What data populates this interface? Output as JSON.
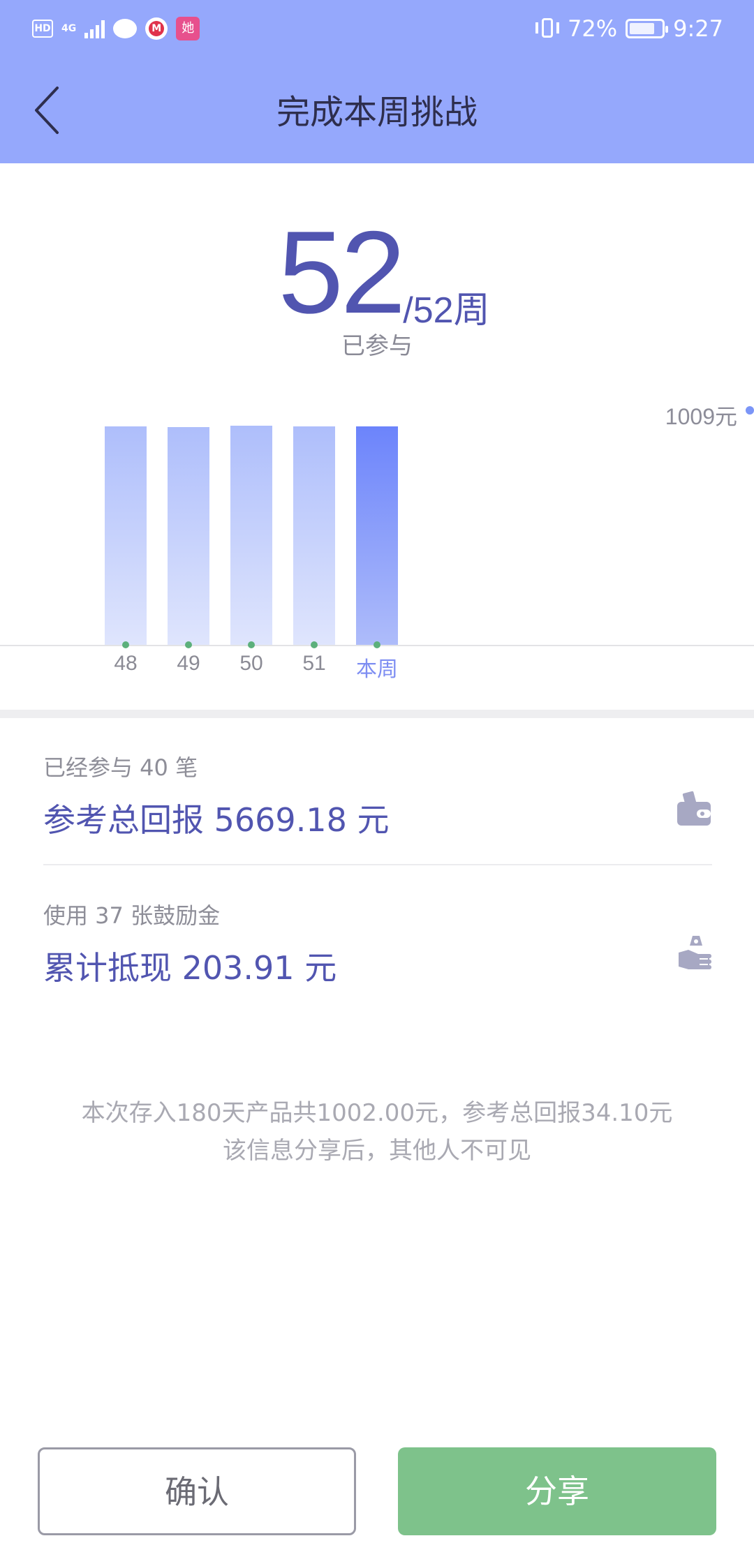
{
  "status_bar": {
    "hd": "HD",
    "network": "4G",
    "app_badge": "她",
    "battery": "72%",
    "time": "9:27"
  },
  "header": {
    "title": "完成本周挑战",
    "background": "#95a8fc"
  },
  "counter": {
    "current": "52",
    "total": "/52周",
    "label": "已参与"
  },
  "chart_data": {
    "type": "bar",
    "goal_label": "1009元",
    "categories": [
      "48",
      "49",
      "50",
      "51",
      "本周"
    ],
    "values": [
      1007,
      1004,
      1009,
      1007,
      1006
    ],
    "ylim": [
      0,
      1009
    ],
    "highlight_index": 4
  },
  "stats": [
    {
      "sub": "已经参与 40 笔",
      "main": "参考总回报 5669.18 元",
      "icon": "wallet-icon"
    },
    {
      "sub": "使用 37 张鼓励金",
      "main": "累计抵现 203.91 元",
      "icon": "money-hand-icon"
    }
  ],
  "note": {
    "line1": "本次存入180天产品共1002.00元，参考总回报34.10元",
    "line2": "该信息分享后，其他人不可见"
  },
  "buttons": {
    "confirm": "确认",
    "share": "分享"
  },
  "colors": {
    "accent": "#5155b0",
    "share_button": "#7ec28b",
    "bar": "#aebefb",
    "bar_current": "#6c84fb"
  }
}
